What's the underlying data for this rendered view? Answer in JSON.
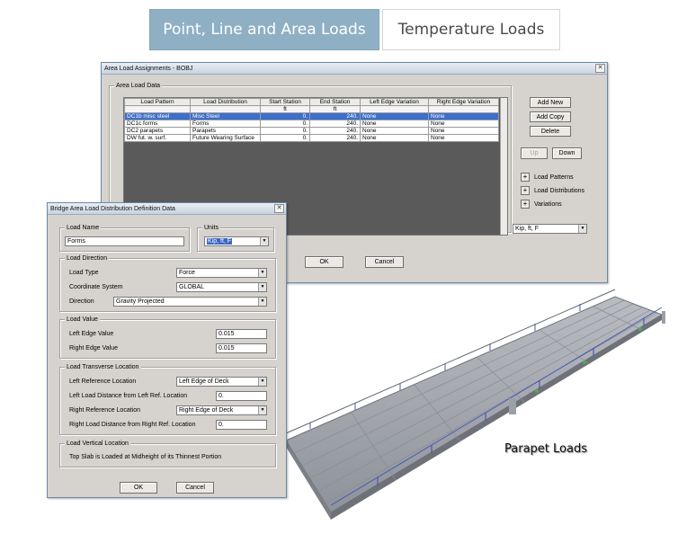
{
  "tabs": [
    {
      "label": "Point, Line and Area Loads",
      "active": true
    },
    {
      "label": "Temperature Loads",
      "active": false
    }
  ],
  "area_window": {
    "title": "Area Load Assignments - BOBJ",
    "group_label": "Area Load Data",
    "columns": [
      "Load Pattern",
      "Load Distribution",
      "Start Station",
      "End Station",
      "Left Edge Variation",
      "Right Edge Variation"
    ],
    "units_row": [
      "",
      "",
      "ft",
      "ft",
      "",
      ""
    ],
    "rows": [
      [
        "DC1b misc steel",
        "Misc Steel",
        "0.",
        "240.",
        "None",
        "None"
      ],
      [
        "DC1c forms",
        "Forms",
        "0.",
        "240.",
        "None",
        "None"
      ],
      [
        "DC2 parapets",
        "Parapets",
        "0.",
        "240.",
        "None",
        "None"
      ],
      [
        "DW fut. w. surf.",
        "Future Wearing Surface",
        "0.",
        "240.",
        "None",
        "None"
      ]
    ],
    "selected_row": 0,
    "buttons": {
      "add_new": "Add New",
      "add_copy": "Add Copy",
      "delete": "Delete",
      "up": "Up",
      "down": "Down",
      "ok": "OK",
      "cancel": "Cancel"
    },
    "tree_items": [
      "Load Patterns",
      "Load Distributions",
      "Variations"
    ],
    "units_combo": "Kip, ft, F"
  },
  "dist_window": {
    "title": "Bridge Area Load Distribution Definition Data",
    "load_name": {
      "group": "Load Name",
      "value": "Forms"
    },
    "units": {
      "group": "Units",
      "value": "Kip, ft, F"
    },
    "load_direction": {
      "group": "Load Direction",
      "load_type_label": "Load Type",
      "load_type": "Force",
      "coord_label": "Coordinate System",
      "coord": "GLOBAL",
      "direction_label": "Direction",
      "direction": "Gravity Projected"
    },
    "load_value": {
      "group": "Load Value",
      "left_label": "Left Edge Value",
      "left": "0.015",
      "right_label": "Right Edge Value",
      "right": "0.015"
    },
    "transverse": {
      "group": "Load Transverse Location",
      "left_ref_label": "Left Reference Location",
      "left_ref": "Left Edge of Deck",
      "left_dist_label": "Left Load Distance from Left Ref. Location",
      "left_dist": "0.",
      "right_ref_label": "Right Reference Location",
      "right_ref": "Right Edge of Deck",
      "right_dist_label": "Right Load Distance from Right Ref. Location",
      "right_dist": "0."
    },
    "vertical": {
      "group": "Load Vertical Location",
      "text": "Top Slab is Loaded at Midheight of its Thinnest Portion"
    },
    "ok": "OK",
    "cancel": "Cancel"
  },
  "caption": "Parapet Loads"
}
